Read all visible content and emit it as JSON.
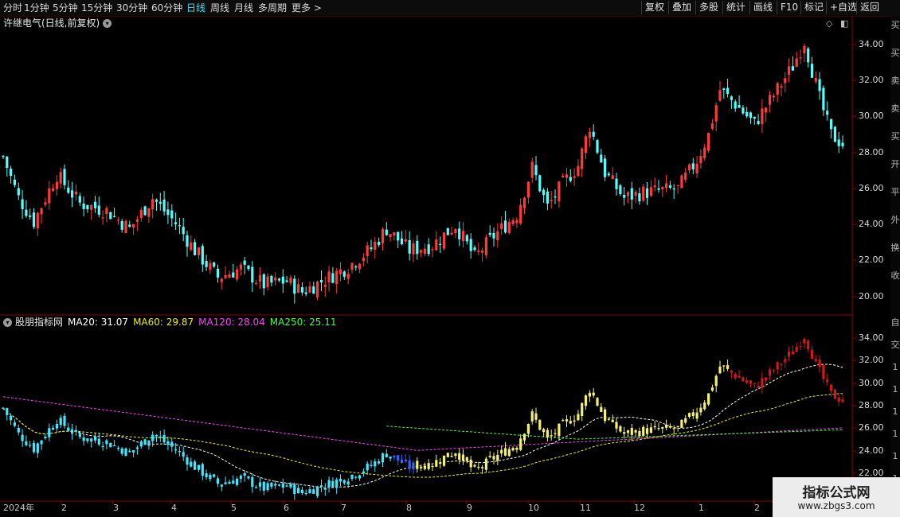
{
  "toolbar": {
    "left": [
      "分时",
      "1分钟",
      "5分钟",
      "15分钟",
      "30分钟",
      "60分钟",
      "日线",
      "周线",
      "月线",
      "多周期",
      "更多 >"
    ],
    "active": "日线",
    "right": [
      "复权",
      "叠加",
      "多股",
      "统计",
      "画线",
      "F10",
      "标记",
      "+自选",
      "返回"
    ]
  },
  "main_panel": {
    "title": "许继电气(日线,前复权)",
    "y_ticks": [
      "34.00",
      "32.00",
      "30.00",
      "28.00",
      "26.00",
      "24.00",
      "22.00",
      "20.00"
    ]
  },
  "indicator_panel": {
    "title": "股朋指标网",
    "ma_labels": [
      {
        "text": "MA20: 31.07",
        "color": "#ffffff"
      },
      {
        "text": "MA60: 29.87",
        "color": "#f0f000"
      },
      {
        "text": "MA120: 28.04",
        "color": "#ff40ff"
      },
      {
        "text": "MA250: 25.11",
        "color": "#40ff40"
      }
    ],
    "y_ticks": [
      "34.00",
      "32.00",
      "30.00",
      "28.00",
      "26.00",
      "24.00",
      "22.00"
    ]
  },
  "date_axis": [
    "2024年",
    "2",
    "3",
    "4",
    "5",
    "6",
    "7",
    "8",
    "9",
    "10",
    "11",
    "12",
    "1",
    "2"
  ],
  "right_strip": [
    "买",
    "买",
    "卖",
    "卖",
    "买",
    "开",
    "平",
    "外",
    "换",
    "收"
  ],
  "right_strip_bottom": [
    "自",
    "交",
    "1",
    "1",
    "1",
    "1",
    "1",
    "1",
    "1",
    "1"
  ],
  "watermark": {
    "title": "指标公式网",
    "url": "www.zbgs3.com"
  },
  "colors": {
    "up": "#ff3a3a",
    "down": "#54ffff",
    "accent": "#2fe6ff",
    "frame": "#8b0000",
    "grid": "#3a0000"
  },
  "chart_data": {
    "type": "candlestick",
    "title": "许继电气(日线,前复权)",
    "x": [
      "2024年",
      "2",
      "3",
      "4",
      "5",
      "6",
      "7",
      "8",
      "9",
      "10",
      "11",
      "12",
      "1",
      "2"
    ],
    "ylim": [
      19.3,
      35.5
    ],
    "close_trend": [
      [
        0,
        27.8
      ],
      [
        4,
        25.5
      ],
      [
        8,
        24.2
      ],
      [
        14,
        26.8
      ],
      [
        20,
        25.2
      ],
      [
        27,
        24.8
      ],
      [
        33,
        23.8
      ],
      [
        39,
        25.5
      ],
      [
        45,
        24.1
      ],
      [
        50,
        22.6
      ],
      [
        56,
        21.1
      ],
      [
        62,
        21.6
      ],
      [
        68,
        20.7
      ],
      [
        74,
        20.9
      ],
      [
        78,
        20.3
      ],
      [
        84,
        21.0
      ],
      [
        90,
        21.7
      ],
      [
        96,
        22.7
      ],
      [
        100,
        23.8
      ],
      [
        106,
        22.6
      ],
      [
        112,
        22.9
      ],
      [
        118,
        24.0
      ],
      [
        123,
        22.2
      ],
      [
        128,
        23.4
      ],
      [
        134,
        24.6
      ],
      [
        138,
        27.2
      ],
      [
        142,
        25.0
      ],
      [
        146,
        26.3
      ],
      [
        150,
        27.3
      ],
      [
        153,
        29.5
      ],
      [
        157,
        26.9
      ],
      [
        162,
        25.5
      ],
      [
        167,
        25.8
      ],
      [
        171,
        25.9
      ],
      [
        176,
        26.0
      ],
      [
        181,
        27.6
      ],
      [
        184,
        29.0
      ],
      [
        187,
        31.5
      ],
      [
        191,
        30.7
      ],
      [
        196,
        29.6
      ],
      [
        201,
        31.2
      ],
      [
        206,
        32.8
      ],
      [
        209,
        34.2
      ],
      [
        213,
        31.0
      ],
      [
        216,
        29.0
      ],
      [
        219,
        28.5
      ]
    ],
    "series": [
      {
        "name": "MA20",
        "values": [
          31.07
        ]
      },
      {
        "name": "MA60",
        "values": [
          29.87
        ]
      },
      {
        "name": "MA120",
        "values": [
          28.04
        ]
      },
      {
        "name": "MA250",
        "values": [
          25.11
        ]
      }
    ]
  }
}
